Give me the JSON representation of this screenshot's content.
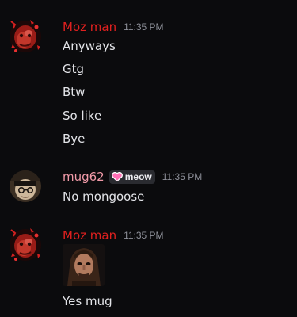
{
  "messages": [
    {
      "author": "Moz man",
      "timestamp": "11:35 PM",
      "lines": [
        "Anyways",
        "Gtg",
        "Btw",
        "So like",
        "Bye"
      ]
    },
    {
      "author": "mug62",
      "badge": "meow",
      "timestamp": "11:35 PM",
      "lines": [
        "No mongoose"
      ]
    },
    {
      "author": "Moz man",
      "timestamp": "11:35 PM",
      "attachment_icon": "image-attachment",
      "lines": [
        "Yes mug"
      ]
    }
  ],
  "colors": {
    "background": "#0b0b0d",
    "moz_name": "#e0201f",
    "mug_name": "#f19aa8",
    "text": "#e3e4e8",
    "timestamp": "#8e9099",
    "badge_bg": "#2a2b30",
    "badge_heart": "#ff6fb5"
  }
}
